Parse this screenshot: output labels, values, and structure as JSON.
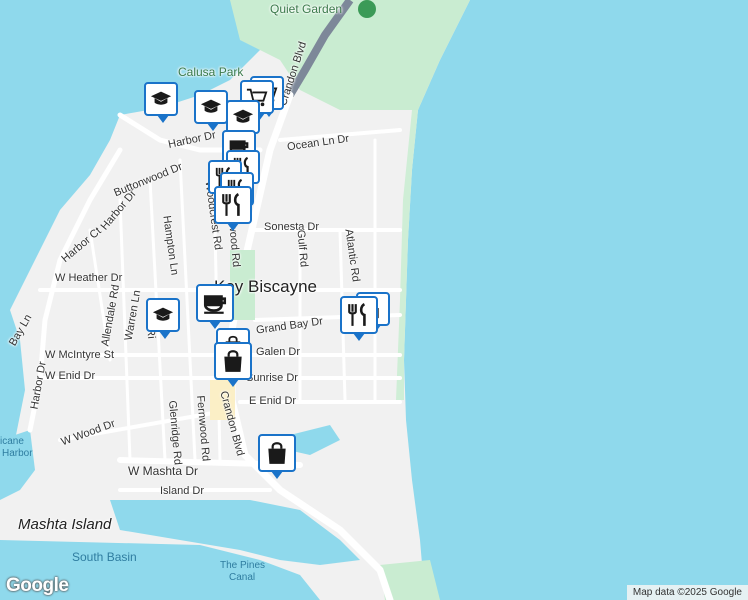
{
  "map": {
    "labels": {
      "quiet_garden": "Quiet Garden",
      "calusa_park": "Calusa Park",
      "key_biscayne": "Key Biscayne",
      "crandon_blvd_north": "Crandon Blvd",
      "crandon_blvd_south": "Crandon Blvd",
      "harbor_dr_top": "Harbor Dr",
      "harbor_dr_left": "Harbor Dr",
      "harbor_dr_west": "Harbor Dr",
      "ocean_ln_dr": "Ocean Ln Dr",
      "buttonwood_dr": "Buttonwood Dr",
      "woodcrest_rd": "Woodcrest Rd",
      "hampton_ln": "Hampton Ln",
      "harbor_ct": "Harbor Ct",
      "sonesta_dr": "Sonesta Dr",
      "gulf_rd": "Gulf Rd",
      "atlantic_rd": "Atlantic Rd",
      "fernwood_rd_upper": "wood Rd",
      "w_heather_dr": "W Heather Dr",
      "allendale_rd": "Allendale Rd",
      "warren_ln": "Warren Ln",
      "bay_ln": "Bay Ln",
      "ridgewood_rd": "Ri",
      "grand_bay_dr": "Grand Bay Dr",
      "galen_dr": "Galen Dr",
      "w_mcintyre_st": "W McIntyre St",
      "w_enid_dr": "W Enid Dr",
      "sunrise_dr": "Sunrise Dr",
      "e_enid_dr": "E Enid Dr",
      "glenridge_rd": "Glenridge Rd",
      "fernwood_rd": "Fernwood Rd",
      "w_wood_dr": "W Wood Dr",
      "w_mashta_dr": "W Mashta Dr",
      "island_dr": "Island Dr",
      "mashta_island": "Mashta Island",
      "south_basin": "South Basin",
      "the_pines_canal_1": "The Pines",
      "the_pines_canal_2": "Canal",
      "hurricane_1": "icane",
      "hurricane_2": "Harbor"
    },
    "markers": [
      {
        "type": "school",
        "icon": "graduation-cap-icon"
      },
      {
        "type": "school",
        "icon": "graduation-cap-icon"
      },
      {
        "type": "school",
        "icon": "graduation-cap-icon"
      },
      {
        "type": "shopping",
        "icon": "shopping-cart-icon"
      },
      {
        "type": "cafe",
        "icon": "coffee-cup-icon"
      },
      {
        "type": "restaurant",
        "icon": "fork-knife-icon"
      },
      {
        "type": "restaurant",
        "icon": "fork-knife-icon"
      },
      {
        "type": "cafe",
        "icon": "coffee-cup-icon"
      },
      {
        "type": "school",
        "icon": "graduation-cap-icon"
      },
      {
        "type": "restaurant",
        "icon": "fork-knife-icon"
      },
      {
        "type": "shopping",
        "icon": "shopping-bag-icon"
      },
      {
        "type": "shopping",
        "icon": "shopping-bag-icon"
      },
      {
        "type": "shopping",
        "icon": "shopping-bag-icon"
      }
    ]
  },
  "footer": {
    "logo": "Google",
    "attribution": "Map data ©2025 Google"
  },
  "colors": {
    "water": "#8fd9ec",
    "land": "#f2f2f2",
    "park": "#c9ecd1",
    "marker_border": "#1a73c9",
    "road": "#ffffff"
  }
}
